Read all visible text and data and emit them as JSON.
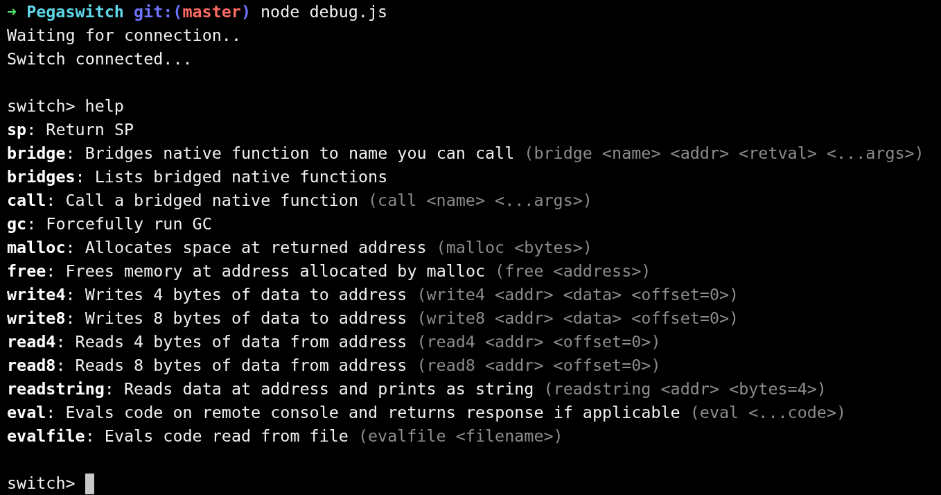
{
  "prompt": {
    "arrow": "➜",
    "directory": "Pegaswitch",
    "git_open": "git:(",
    "branch": "master",
    "git_close": ")",
    "command": "node debug.js"
  },
  "output": [
    "Waiting for connection..",
    "Switch connected..."
  ],
  "repl": {
    "prompt": "switch>",
    "command": "help"
  },
  "help_entries": [
    {
      "text": "**sp**: Return SP"
    },
    {
      "text": "**bridge**: Bridges native function to name you can call",
      "usage": "(bridge <name> <addr> <retval> <...args>)"
    },
    {
      "text": "**bridges**: Lists bridged native functions"
    },
    {
      "text": "**call**: Call a bridged native function",
      "usage": "(call <name> <...args>)"
    },
    {
      "text": "**gc**: Forcefully run GC"
    },
    {
      "text": "**malloc**: Allocates space at returned address",
      "usage": "(malloc <bytes>)"
    },
    {
      "text": "**free**: Frees memory at address allocated by malloc",
      "usage": "(free <address>)"
    },
    {
      "text": "**write4**: Writes 4 bytes of data to address",
      "usage": "(write4 <addr> <data> <offset=0>)"
    },
    {
      "text": "**write8**: Writes 8 bytes of data to address",
      "usage": "(write8 <addr> <data> <offset=0>)"
    },
    {
      "text": "**read4**: Reads 4 bytes of data from address",
      "usage": "(read4 <addr> <offset=0>)"
    },
    {
      "text": "**read8**: Reads 8 bytes of data from address",
      "usage": "(read8 <addr> <offset=0>)"
    },
    {
      "text": "**readstring**: Reads data at address and prints as string",
      "usage": "(readstring <addr> <bytes=4>)"
    },
    {
      "text": "**eval**: Evals code on remote console and returns response if applicable",
      "usage": "(eval <...code>)"
    },
    {
      "text": "**evalfile**: Evals code read from file",
      "usage": "(evalfile <filename>)"
    }
  ],
  "cursor_prompt": "switch>"
}
